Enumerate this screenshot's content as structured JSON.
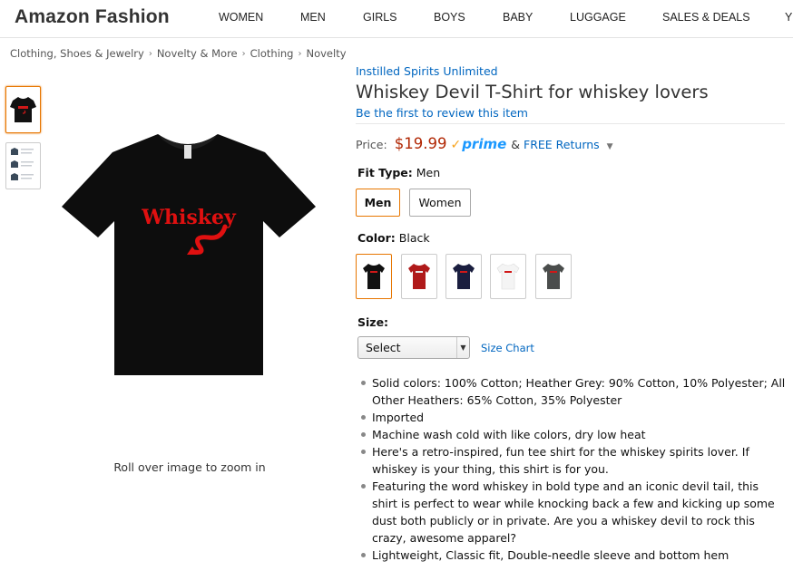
{
  "header": {
    "brand": "Amazon Fashion",
    "nav": [
      "WOMEN",
      "MEN",
      "GIRLS",
      "BOYS",
      "BABY",
      "LUGGAGE",
      "SALES & DEALS",
      "Y"
    ]
  },
  "breadcrumb": [
    "Clothing, Shoes & Jewelry",
    "Novelty & More",
    "Clothing",
    "Novelty"
  ],
  "product": {
    "brand_link": "Instilled Spirits Unlimited",
    "title": "Whiskey Devil T-Shirt for whiskey lovers",
    "review_link": "Be the first to review this item",
    "shirt_print": "Whiskey",
    "zoom_hint": "Roll over image to zoom in"
  },
  "price": {
    "label": "Price:",
    "value": "$19.99",
    "prime_check": "✓",
    "prime_word": "prime",
    "amp": "&",
    "free_returns": "FREE Returns",
    "caret": "▼"
  },
  "fit_type": {
    "label": "Fit Type:",
    "selected": "Men",
    "options": [
      "Men",
      "Women"
    ]
  },
  "color": {
    "label": "Color:",
    "selected": "Black",
    "swatches": [
      "#111111",
      "#b01a1a",
      "#1a1e3f",
      "#f4f4f4",
      "#4a4d4c"
    ]
  },
  "size": {
    "label": "Size:",
    "select_value": "Select",
    "arrow": "▼",
    "chart_link": "Size Chart"
  },
  "bullets": [
    "Solid colors: 100% Cotton; Heather Grey: 90% Cotton, 10% Polyester; All Other Heathers: 65% Cotton, 35% Polyester",
    "Imported",
    "Machine wash cold with like colors, dry low heat",
    "Here's a retro-inspired, fun tee shirt for the whiskey spirits lover. If whiskey is your thing, this shirt is for you.",
    "Featuring the word whiskey in bold type and an iconic devil tail, this shirt is perfect to wear while knocking back a few and kicking up some dust both publicly or in private. Are you a whiskey devil to rock this crazy, awesome apparel?",
    "Lightweight, Classic fit, Double-needle sleeve and bottom hem"
  ],
  "colors": {
    "accent_orange": "#e77600",
    "link_blue": "#0066c0",
    "price_red": "#b12704",
    "prime_blue": "#1a98ff",
    "print_red": "#e01010"
  }
}
